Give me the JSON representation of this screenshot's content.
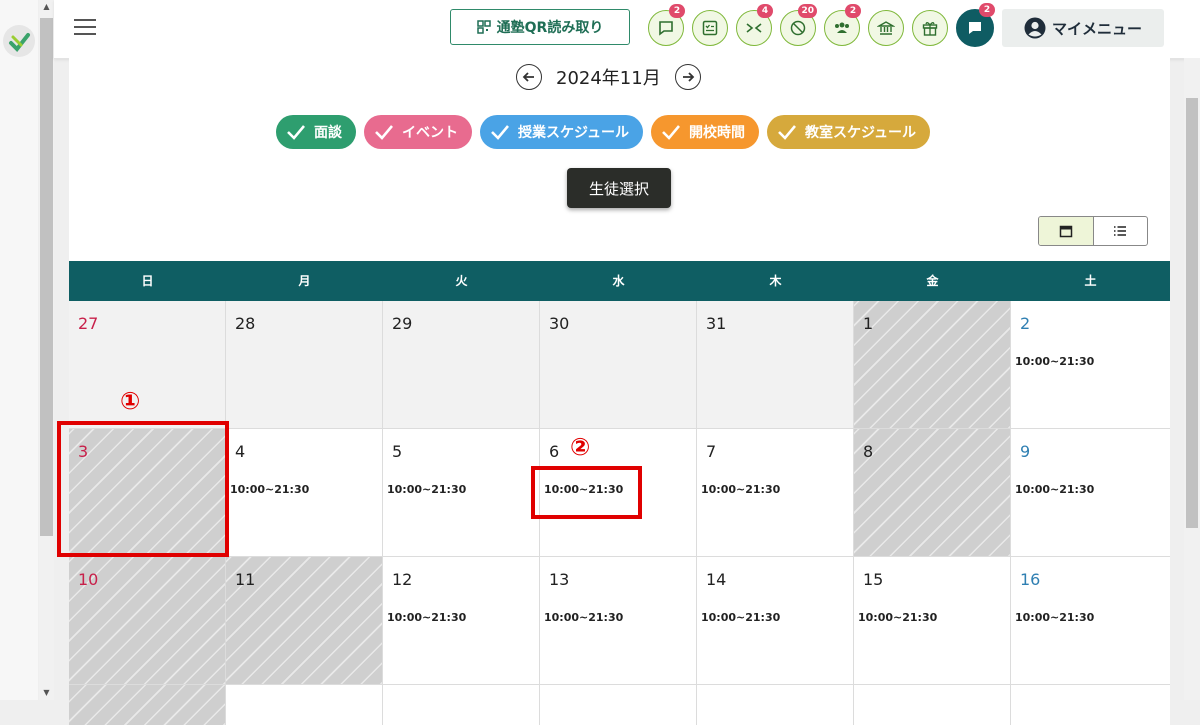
{
  "header": {
    "qr_label": "通塾QR読み取り",
    "icons": [
      {
        "name": "chat-bubble-icon",
        "badge": "2"
      },
      {
        "name": "checklist-icon",
        "badge": ""
      },
      {
        "name": "arrows-in-icon",
        "badge": "4"
      },
      {
        "name": "no-entry-icon",
        "badge": "20"
      },
      {
        "name": "group-icon",
        "badge": "2"
      },
      {
        "name": "bank-icon",
        "badge": ""
      },
      {
        "name": "gift-icon",
        "badge": ""
      },
      {
        "name": "message-icon",
        "badge": "2"
      }
    ],
    "my_menu": "マイメニュー"
  },
  "calendar": {
    "month_title": "2024年11月",
    "filters": [
      {
        "label": "面談",
        "color": "#2e9e6f"
      },
      {
        "label": "イベント",
        "color": "#e86b8f"
      },
      {
        "label": "授業スケジュール",
        "color": "#4aa3e6"
      },
      {
        "label": "開校時間",
        "color": "#f6972e"
      },
      {
        "label": "教室スケジュール",
        "color": "#d6a93c"
      }
    ],
    "student_select": "生徒選択",
    "weekdays": [
      "日",
      "月",
      "火",
      "水",
      "木",
      "金",
      "土"
    ],
    "weeks": [
      [
        {
          "day": "27",
          "time": ""
        },
        {
          "day": "28",
          "time": ""
        },
        {
          "day": "29",
          "time": ""
        },
        {
          "day": "30",
          "time": ""
        },
        {
          "day": "31",
          "time": ""
        },
        {
          "day": "1",
          "time": ""
        },
        {
          "day": "2",
          "time": "10:00~21:30"
        }
      ],
      [
        {
          "day": "3",
          "time": ""
        },
        {
          "day": "4",
          "time": "10:00~21:30"
        },
        {
          "day": "5",
          "time": "10:00~21:30"
        },
        {
          "day": "6",
          "time": "10:00~21:30"
        },
        {
          "day": "7",
          "time": "10:00~21:30"
        },
        {
          "day": "8",
          "time": ""
        },
        {
          "day": "9",
          "time": "10:00~21:30"
        }
      ],
      [
        {
          "day": "10",
          "time": ""
        },
        {
          "day": "11",
          "time": ""
        },
        {
          "day": "12",
          "time": "10:00~21:30"
        },
        {
          "day": "13",
          "time": "10:00~21:30"
        },
        {
          "day": "14",
          "time": "10:00~21:30"
        },
        {
          "day": "15",
          "time": "10:00~21:30"
        },
        {
          "day": "16",
          "time": "10:00~21:30"
        }
      ]
    ]
  },
  "annotations": {
    "marker_1": "①",
    "marker_2": "②"
  }
}
